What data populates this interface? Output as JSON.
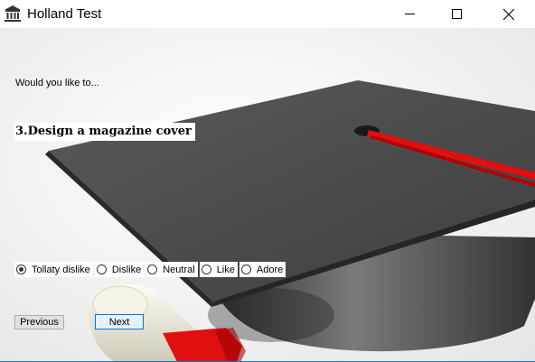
{
  "window": {
    "title": "Holland Test",
    "app_icon": "bank-building-icon",
    "controls": [
      "minimize-icon",
      "maximize-icon",
      "close-icon"
    ]
  },
  "form": {
    "prompt": "Would you like to...",
    "question": "3.Design a magazine cover",
    "options": [
      {
        "label": "Tollaty dislike",
        "checked": true
      },
      {
        "label": "Dislike",
        "checked": false
      },
      {
        "label": "Neutral",
        "checked": false
      },
      {
        "label": "Like",
        "checked": false
      },
      {
        "label": "Adore",
        "checked": false
      }
    ],
    "previous_label": "Previous",
    "next_label": "Next"
  },
  "colors": {
    "accent": "#0078d7",
    "client_bg": "#f0f0f0",
    "cap": "#4a4a4a",
    "tassel": "#e01010"
  }
}
